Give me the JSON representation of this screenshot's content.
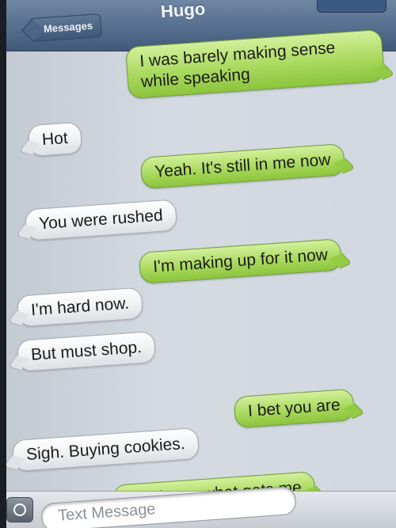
{
  "navbar": {
    "back_label": "Messages",
    "title": "Hugo"
  },
  "messages": [
    {
      "direction": "out",
      "text": "I was barely making sense while speaking"
    },
    {
      "direction": "in",
      "text": "Hot"
    },
    {
      "direction": "out",
      "text": "Yeah. It's still in me now"
    },
    {
      "direction": "in",
      "text": "You were rushed"
    },
    {
      "direction": "out",
      "text": "I'm making up for it now"
    },
    {
      "direction": "in",
      "text": "I'm hard now."
    },
    {
      "direction": "in",
      "text": "But must shop."
    },
    {
      "direction": "out",
      "text": "I bet you are"
    },
    {
      "direction": "in",
      "text": "Sigh. Buying cookies."
    },
    {
      "direction": "out",
      "text": "You know what gets me"
    }
  ],
  "composer": {
    "placeholder": "Text Message",
    "camera_icon": "camera-icon"
  },
  "colors": {
    "outgoing": "#a9d95e",
    "incoming": "#eef0f2",
    "navbar": "#566f8e"
  }
}
